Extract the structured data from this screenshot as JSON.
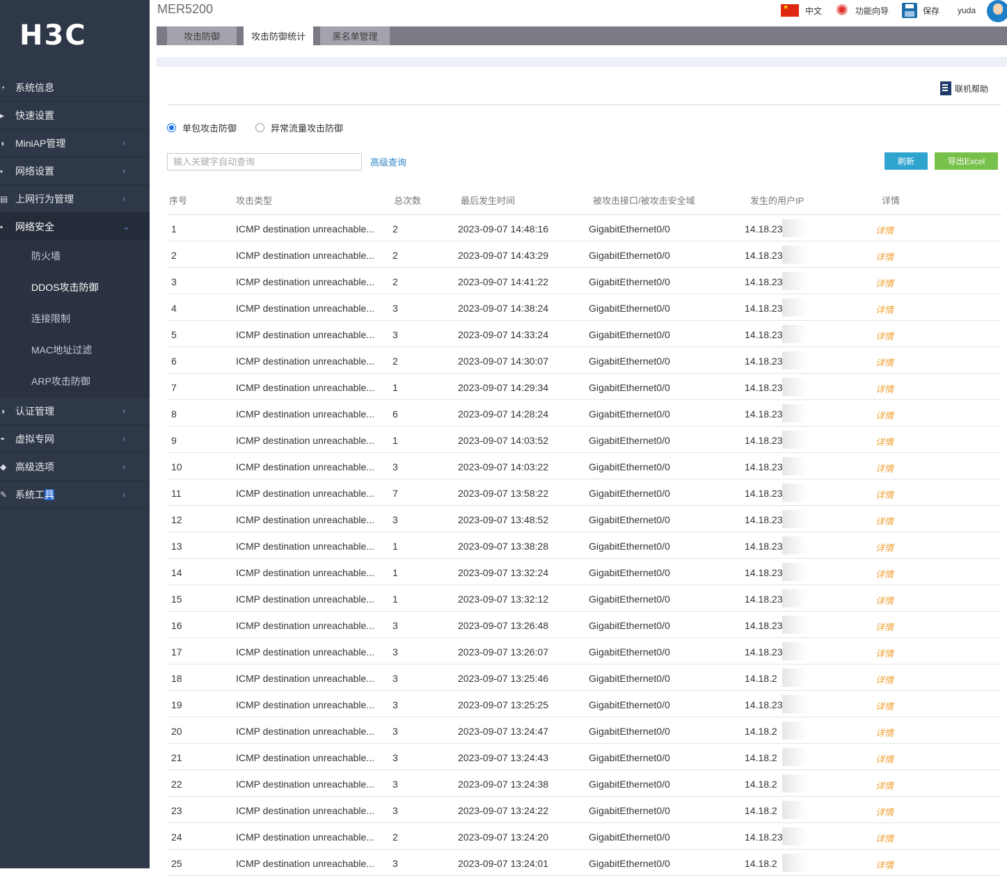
{
  "brand": "H3C",
  "device": "MER5200",
  "topbar": {
    "lang": "中文",
    "wizard": "功能向导",
    "save": "保存",
    "user": "yuda"
  },
  "tabs": [
    "攻击防御",
    "攻击防御统计",
    "黑名单管理"
  ],
  "sidebar": {
    "items": [
      {
        "label": "系统信息",
        "icon": "wave-icon"
      },
      {
        "label": "快速设置",
        "icon": "arrow-icon"
      },
      {
        "label": "MiniAP管理",
        "icon": "ap-icon"
      },
      {
        "label": "网络设置",
        "icon": "network-icon"
      },
      {
        "label": "上网行为管理",
        "icon": "behavior-icon"
      },
      {
        "label": "网络安全",
        "icon": "shield-icon"
      }
    ],
    "sub_items": [
      "防火墙",
      "DDOS攻击防御",
      "连接限制",
      "MAC地址过滤",
      "ARP攻击防御"
    ],
    "items2": [
      {
        "label": "认证管理",
        "icon": "auth-icon"
      },
      {
        "label": "虚拟专网",
        "icon": "vpn-icon"
      },
      {
        "label": "高级选项",
        "icon": "advanced-icon"
      },
      {
        "label_a": "系统工",
        "label_b": "具",
        "icon": "tools-icon"
      }
    ]
  },
  "help": "联机帮助",
  "radios": {
    "single": "单包攻击防御",
    "abnormal": "异常流量攻击防御"
  },
  "search": {
    "placeholder": "输入关键字自动查询",
    "advanced": "高级查询"
  },
  "buttons": {
    "refresh": "刷新",
    "export": "导出Excel"
  },
  "columns": [
    "序号",
    "攻击类型",
    "总次数",
    "最后发生时间",
    "被攻击接口/被攻击安全域",
    "发生的用户IP",
    "详情"
  ],
  "rows": [
    {
      "no": "1",
      "type": "ICMP destination unreachable...",
      "count": "2",
      "time": "2023-09-07 14:48:16",
      "iface": "GigabitEthernet0/0",
      "ip": "14.18.23",
      "detail": "详情"
    },
    {
      "no": "2",
      "type": "ICMP destination unreachable...",
      "count": "2",
      "time": "2023-09-07 14:43:29",
      "iface": "GigabitEthernet0/0",
      "ip": "14.18.23",
      "detail": "详情"
    },
    {
      "no": "3",
      "type": "ICMP destination unreachable...",
      "count": "2",
      "time": "2023-09-07 14:41:22",
      "iface": "GigabitEthernet0/0",
      "ip": "14.18.23",
      "detail": "详情"
    },
    {
      "no": "4",
      "type": "ICMP destination unreachable...",
      "count": "3",
      "time": "2023-09-07 14:38:24",
      "iface": "GigabitEthernet0/0",
      "ip": "14.18.23",
      "detail": "详情"
    },
    {
      "no": "5",
      "type": "ICMP destination unreachable...",
      "count": "3",
      "time": "2023-09-07 14:33:24",
      "iface": "GigabitEthernet0/0",
      "ip": "14.18.23",
      "detail": "详情"
    },
    {
      "no": "6",
      "type": "ICMP destination unreachable...",
      "count": "2",
      "time": "2023-09-07 14:30:07",
      "iface": "GigabitEthernet0/0",
      "ip": "14.18.23",
      "detail": "详情"
    },
    {
      "no": "7",
      "type": "ICMP destination unreachable...",
      "count": "1",
      "time": "2023-09-07 14:29:34",
      "iface": "GigabitEthernet0/0",
      "ip": "14.18.23",
      "detail": "详情"
    },
    {
      "no": "8",
      "type": "ICMP destination unreachable...",
      "count": "6",
      "time": "2023-09-07 14:28:24",
      "iface": "GigabitEthernet0/0",
      "ip": "14.18.23",
      "detail": "详情"
    },
    {
      "no": "9",
      "type": "ICMP destination unreachable...",
      "count": "1",
      "time": "2023-09-07 14:03:52",
      "iface": "GigabitEthernet0/0",
      "ip": "14.18.23",
      "detail": "详情"
    },
    {
      "no": "10",
      "type": "ICMP destination unreachable...",
      "count": "3",
      "time": "2023-09-07 14:03:22",
      "iface": "GigabitEthernet0/0",
      "ip": "14.18.23",
      "detail": "详情"
    },
    {
      "no": "11",
      "type": "ICMP destination unreachable...",
      "count": "7",
      "time": "2023-09-07 13:58:22",
      "iface": "GigabitEthernet0/0",
      "ip": "14.18.23",
      "detail": "详情"
    },
    {
      "no": "12",
      "type": "ICMP destination unreachable...",
      "count": "3",
      "time": "2023-09-07 13:48:52",
      "iface": "GigabitEthernet0/0",
      "ip": "14.18.23",
      "detail": "详情"
    },
    {
      "no": "13",
      "type": "ICMP destination unreachable...",
      "count": "1",
      "time": "2023-09-07 13:38:28",
      "iface": "GigabitEthernet0/0",
      "ip": "14.18.23",
      "detail": "详情"
    },
    {
      "no": "14",
      "type": "ICMP destination unreachable...",
      "count": "1",
      "time": "2023-09-07 13:32:24",
      "iface": "GigabitEthernet0/0",
      "ip": "14.18.23",
      "detail": "详情"
    },
    {
      "no": "15",
      "type": "ICMP destination unreachable...",
      "count": "1",
      "time": "2023-09-07 13:32:12",
      "iface": "GigabitEthernet0/0",
      "ip": "14.18.23",
      "detail": "详情"
    },
    {
      "no": "16",
      "type": "ICMP destination unreachable...",
      "count": "3",
      "time": "2023-09-07 13:26:48",
      "iface": "GigabitEthernet0/0",
      "ip": "14.18.23",
      "detail": "详情"
    },
    {
      "no": "17",
      "type": "ICMP destination unreachable...",
      "count": "3",
      "time": "2023-09-07 13:26:07",
      "iface": "GigabitEthernet0/0",
      "ip": "14.18.23",
      "detail": "详情"
    },
    {
      "no": "18",
      "type": "ICMP destination unreachable...",
      "count": "3",
      "time": "2023-09-07 13:25:46",
      "iface": "GigabitEthernet0/0",
      "ip": "14.18.2",
      "detail": "详情"
    },
    {
      "no": "19",
      "type": "ICMP destination unreachable...",
      "count": "3",
      "time": "2023-09-07 13:25:25",
      "iface": "GigabitEthernet0/0",
      "ip": "14.18.23",
      "detail": "详情"
    },
    {
      "no": "20",
      "type": "ICMP destination unreachable...",
      "count": "3",
      "time": "2023-09-07 13:24:47",
      "iface": "GigabitEthernet0/0",
      "ip": "14.18.2",
      "detail": "详情"
    },
    {
      "no": "21",
      "type": "ICMP destination unreachable...",
      "count": "3",
      "time": "2023-09-07 13:24:43",
      "iface": "GigabitEthernet0/0",
      "ip": "14.18.2",
      "detail": "详情"
    },
    {
      "no": "22",
      "type": "ICMP destination unreachable...",
      "count": "3",
      "time": "2023-09-07 13:24:38",
      "iface": "GigabitEthernet0/0",
      "ip": "14.18.2",
      "detail": "详情"
    },
    {
      "no": "23",
      "type": "ICMP destination unreachable...",
      "count": "3",
      "time": "2023-09-07 13:24:22",
      "iface": "GigabitEthernet0/0",
      "ip": "14.18.2",
      "detail": "详情"
    },
    {
      "no": "24",
      "type": "ICMP destination unreachable...",
      "count": "2",
      "time": "2023-09-07 13:24:20",
      "iface": "GigabitEthernet0/0",
      "ip": "14.18.23",
      "detail": "详情"
    },
    {
      "no": "25",
      "type": "ICMP destination unreachable...",
      "count": "3",
      "time": "2023-09-07 13:24:01",
      "iface": "GigabitEthernet0/0",
      "ip": "14.18.2",
      "detail": "详情"
    }
  ]
}
